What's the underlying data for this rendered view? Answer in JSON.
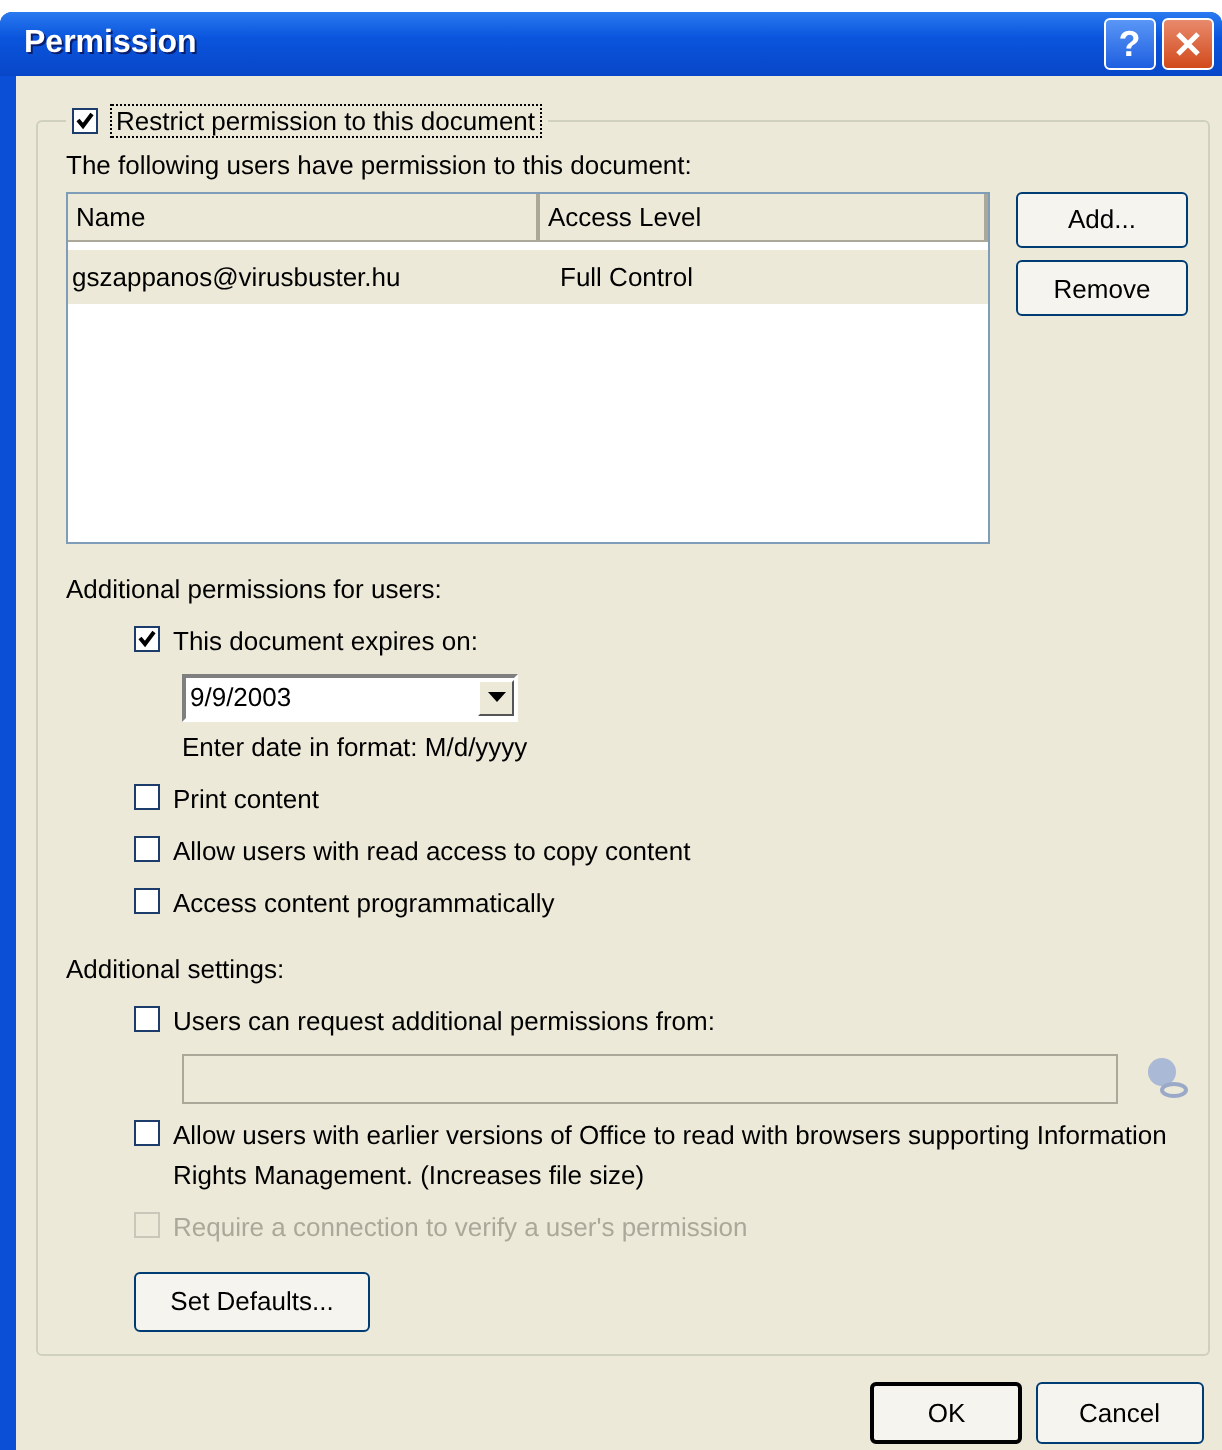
{
  "window": {
    "title": "Permission",
    "help": "?"
  },
  "restrict": {
    "label": "Restrict permission to this document",
    "checked": true
  },
  "users_label": "The following users have permission to this document:",
  "users_table": {
    "columns": [
      "Name",
      "Access Level"
    ],
    "rows": [
      {
        "cells": [
          "gszappanos@virusbuster.hu",
          "Full Control"
        ],
        "selected": true
      }
    ]
  },
  "side_buttons": [
    "Add...",
    "Remove"
  ],
  "additional_permissions": {
    "heading": "Additional permissions for users:",
    "options": [
      {
        "kind": "date",
        "label": "This document expires on:",
        "checked": true,
        "value": "9/9/2003",
        "hint": "Enter date in format: M/d/yyyy"
      },
      {
        "kind": "checkbox",
        "label": "Print content",
        "checked": false
      },
      {
        "kind": "checkbox",
        "label": "Allow users with read access to copy content",
        "checked": false
      },
      {
        "kind": "checkbox",
        "label": "Access content programmatically",
        "checked": false
      }
    ]
  },
  "additional_settings": {
    "heading": "Additional settings:",
    "options": [
      {
        "kind": "field",
        "label": "Users can request additional permissions from:",
        "checked": false,
        "disabled": false
      },
      {
        "kind": "checkbox",
        "label": "Allow users with earlier versions of Office to read with browsers supporting Information Rights Management. (Increases file size)",
        "checked": false,
        "disabled": false
      },
      {
        "kind": "checkbox",
        "label": "Require a connection to verify a user's permission",
        "checked": false,
        "disabled": true
      }
    ]
  },
  "set_defaults": "Set Defaults...",
  "footer_buttons": [
    {
      "label": "OK",
      "default": true
    },
    {
      "label": "Cancel",
      "default": false
    }
  ]
}
